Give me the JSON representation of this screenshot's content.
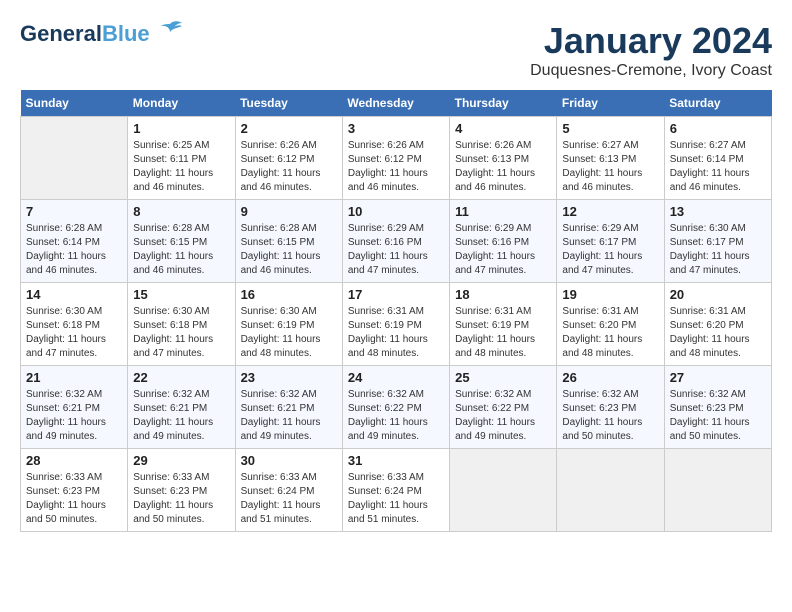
{
  "logo": {
    "line1": "General",
    "line2": "Blue"
  },
  "title": "January 2024",
  "location": "Duquesnes-Cremone, Ivory Coast",
  "weekdays": [
    "Sunday",
    "Monday",
    "Tuesday",
    "Wednesday",
    "Thursday",
    "Friday",
    "Saturday"
  ],
  "weeks": [
    [
      {
        "day": "",
        "empty": true
      },
      {
        "day": "1",
        "sunrise": "6:25 AM",
        "sunset": "6:11 PM",
        "daylight": "11 hours and 46 minutes."
      },
      {
        "day": "2",
        "sunrise": "6:26 AM",
        "sunset": "6:12 PM",
        "daylight": "11 hours and 46 minutes."
      },
      {
        "day": "3",
        "sunrise": "6:26 AM",
        "sunset": "6:12 PM",
        "daylight": "11 hours and 46 minutes."
      },
      {
        "day": "4",
        "sunrise": "6:26 AM",
        "sunset": "6:13 PM",
        "daylight": "11 hours and 46 minutes."
      },
      {
        "day": "5",
        "sunrise": "6:27 AM",
        "sunset": "6:13 PM",
        "daylight": "11 hours and 46 minutes."
      },
      {
        "day": "6",
        "sunrise": "6:27 AM",
        "sunset": "6:14 PM",
        "daylight": "11 hours and 46 minutes."
      }
    ],
    [
      {
        "day": "7",
        "sunrise": "6:28 AM",
        "sunset": "6:14 PM",
        "daylight": "11 hours and 46 minutes."
      },
      {
        "day": "8",
        "sunrise": "6:28 AM",
        "sunset": "6:15 PM",
        "daylight": "11 hours and 46 minutes."
      },
      {
        "day": "9",
        "sunrise": "6:28 AM",
        "sunset": "6:15 PM",
        "daylight": "11 hours and 46 minutes."
      },
      {
        "day": "10",
        "sunrise": "6:29 AM",
        "sunset": "6:16 PM",
        "daylight": "11 hours and 47 minutes."
      },
      {
        "day": "11",
        "sunrise": "6:29 AM",
        "sunset": "6:16 PM",
        "daylight": "11 hours and 47 minutes."
      },
      {
        "day": "12",
        "sunrise": "6:29 AM",
        "sunset": "6:17 PM",
        "daylight": "11 hours and 47 minutes."
      },
      {
        "day": "13",
        "sunrise": "6:30 AM",
        "sunset": "6:17 PM",
        "daylight": "11 hours and 47 minutes."
      }
    ],
    [
      {
        "day": "14",
        "sunrise": "6:30 AM",
        "sunset": "6:18 PM",
        "daylight": "11 hours and 47 minutes."
      },
      {
        "day": "15",
        "sunrise": "6:30 AM",
        "sunset": "6:18 PM",
        "daylight": "11 hours and 47 minutes."
      },
      {
        "day": "16",
        "sunrise": "6:30 AM",
        "sunset": "6:19 PM",
        "daylight": "11 hours and 48 minutes."
      },
      {
        "day": "17",
        "sunrise": "6:31 AM",
        "sunset": "6:19 PM",
        "daylight": "11 hours and 48 minutes."
      },
      {
        "day": "18",
        "sunrise": "6:31 AM",
        "sunset": "6:19 PM",
        "daylight": "11 hours and 48 minutes."
      },
      {
        "day": "19",
        "sunrise": "6:31 AM",
        "sunset": "6:20 PM",
        "daylight": "11 hours and 48 minutes."
      },
      {
        "day": "20",
        "sunrise": "6:31 AM",
        "sunset": "6:20 PM",
        "daylight": "11 hours and 48 minutes."
      }
    ],
    [
      {
        "day": "21",
        "sunrise": "6:32 AM",
        "sunset": "6:21 PM",
        "daylight": "11 hours and 49 minutes."
      },
      {
        "day": "22",
        "sunrise": "6:32 AM",
        "sunset": "6:21 PM",
        "daylight": "11 hours and 49 minutes."
      },
      {
        "day": "23",
        "sunrise": "6:32 AM",
        "sunset": "6:21 PM",
        "daylight": "11 hours and 49 minutes."
      },
      {
        "day": "24",
        "sunrise": "6:32 AM",
        "sunset": "6:22 PM",
        "daylight": "11 hours and 49 minutes."
      },
      {
        "day": "25",
        "sunrise": "6:32 AM",
        "sunset": "6:22 PM",
        "daylight": "11 hours and 49 minutes."
      },
      {
        "day": "26",
        "sunrise": "6:32 AM",
        "sunset": "6:23 PM",
        "daylight": "11 hours and 50 minutes."
      },
      {
        "day": "27",
        "sunrise": "6:32 AM",
        "sunset": "6:23 PM",
        "daylight": "11 hours and 50 minutes."
      }
    ],
    [
      {
        "day": "28",
        "sunrise": "6:33 AM",
        "sunset": "6:23 PM",
        "daylight": "11 hours and 50 minutes."
      },
      {
        "day": "29",
        "sunrise": "6:33 AM",
        "sunset": "6:23 PM",
        "daylight": "11 hours and 50 minutes."
      },
      {
        "day": "30",
        "sunrise": "6:33 AM",
        "sunset": "6:24 PM",
        "daylight": "11 hours and 51 minutes."
      },
      {
        "day": "31",
        "sunrise": "6:33 AM",
        "sunset": "6:24 PM",
        "daylight": "11 hours and 51 minutes."
      },
      {
        "day": "",
        "empty": true
      },
      {
        "day": "",
        "empty": true
      },
      {
        "day": "",
        "empty": true
      }
    ]
  ],
  "labels": {
    "sunrise": "Sunrise:",
    "sunset": "Sunset:",
    "daylight": "Daylight:"
  }
}
